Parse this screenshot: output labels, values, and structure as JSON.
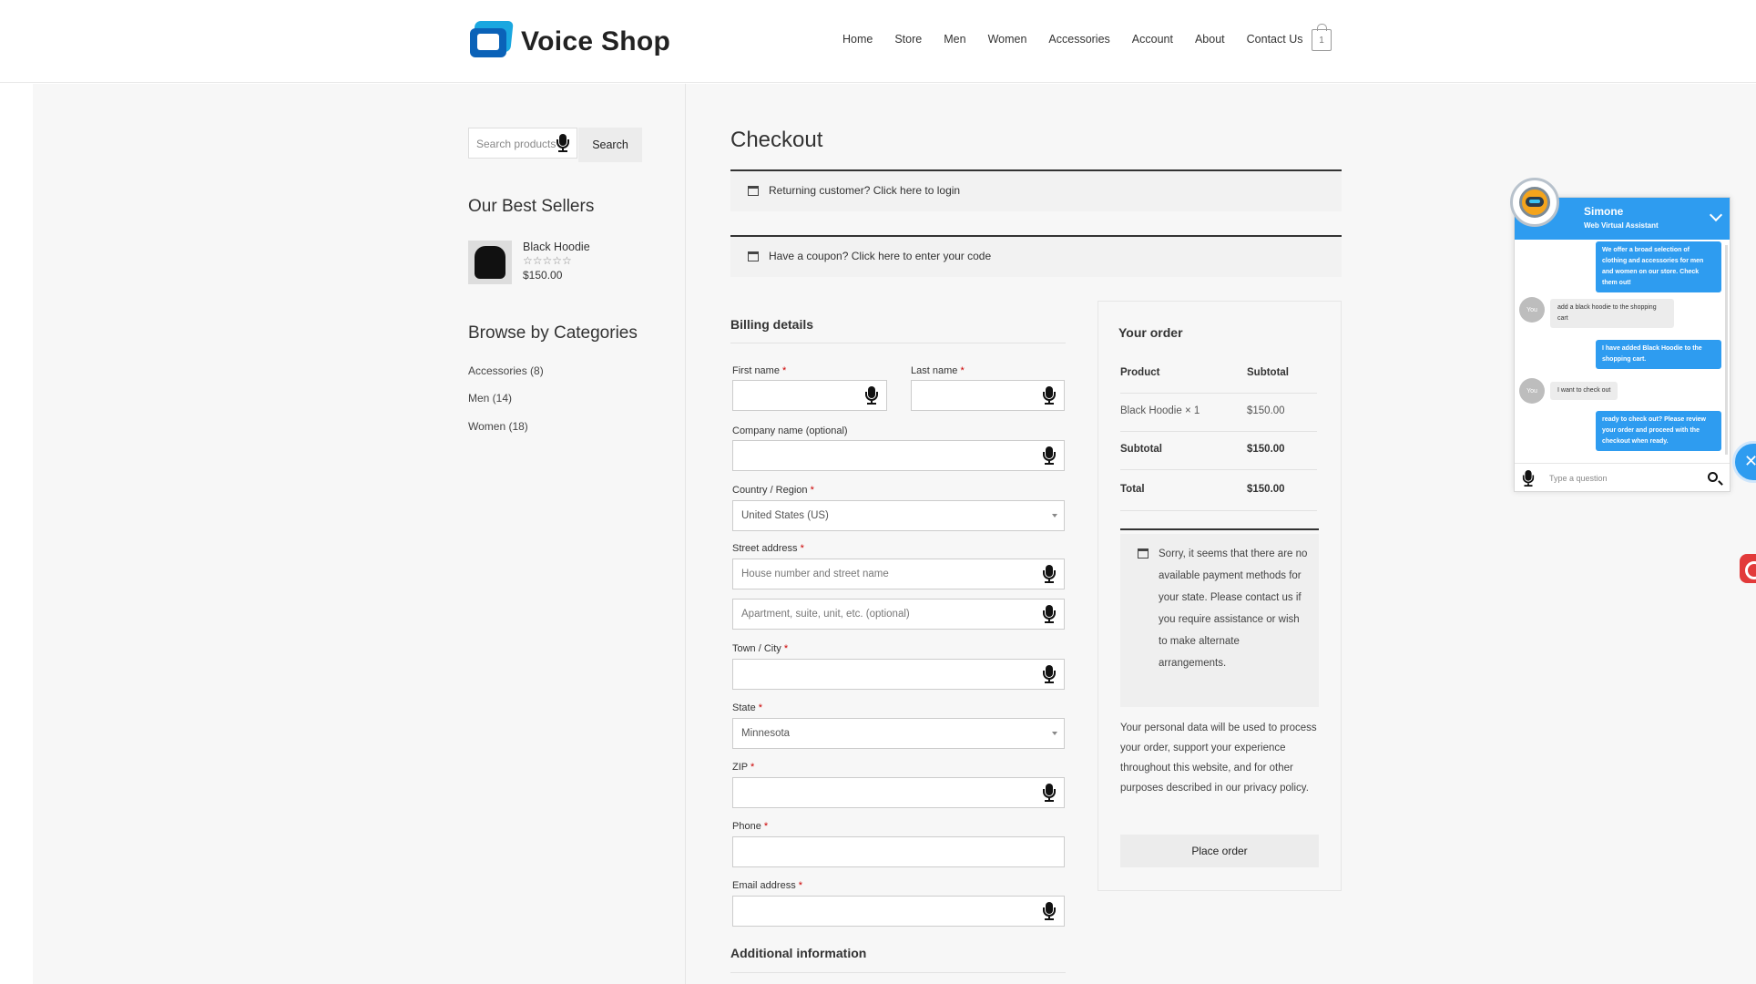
{
  "brand": {
    "name": "Voice Shop"
  },
  "nav": {
    "items": [
      "Home",
      "Store",
      "Men",
      "Women",
      "Accessories",
      "Account",
      "About",
      "Contact Us"
    ],
    "cart_count": "1"
  },
  "sidebar": {
    "search_placeholder": "Search products",
    "search_button": "Search",
    "best_sellers_title": "Our Best Sellers",
    "best_seller": {
      "name": "Black Hoodie",
      "stars": "☆☆☆☆☆",
      "price": "$150.00"
    },
    "categories_title": "Browse by Categories",
    "categories": [
      "Accessories (8)",
      "Men (14)",
      "Women (18)"
    ]
  },
  "checkout": {
    "title": "Checkout",
    "returning_notice": "Returning customer? Click here to login",
    "coupon_notice": "Have a coupon? Click here to enter your code",
    "billing_title": "Billing details",
    "labels": {
      "first_name": "First name",
      "last_name": "Last name",
      "company": "Company name (optional)",
      "country": "Country / Region",
      "street": "Street address",
      "town": "Town / City",
      "state": "State",
      "zip": "ZIP",
      "phone": "Phone",
      "email": "Email address"
    },
    "required_mark": "*",
    "values": {
      "country": "United States (US)",
      "state": "Minnesota"
    },
    "placeholders": {
      "street1": "House number and street name",
      "street2": "Apartment, suite, unit, etc. (optional)"
    },
    "additional_title": "Additional information"
  },
  "order": {
    "title": "Your order",
    "col_product": "Product",
    "col_subtotal": "Subtotal",
    "item_name": "Black Hoodie  × 1",
    "item_price": "$150.00",
    "subtotal_label": "Subtotal",
    "subtotal_value": "$150.00",
    "total_label": "Total",
    "total_value": "$150.00",
    "payment_notice": "Sorry, it seems that there are no available payment methods for your state. Please contact us if you require assistance or wish to make alternate arrangements.",
    "privacy": "Your personal data will be used to process your order, support your experience throughout this website, and for other purposes described in our privacy policy.",
    "place_order": "Place order"
  },
  "chat": {
    "name": "Simone",
    "role": "Web Virtual Assistant",
    "you_label": "You",
    "messages": [
      {
        "from": "bot",
        "text": "We offer a broad selection of clothing and accessories for men and women on our store. Check them out!"
      },
      {
        "from": "you",
        "text": "add a black hoodie to the shopping cart"
      },
      {
        "from": "bot",
        "text": "I have added Black Hoodie to the shopping cart."
      },
      {
        "from": "you",
        "text": "I want to check out"
      },
      {
        "from": "bot",
        "text": "ready to check out? Please review your order and proceed with the checkout when ready."
      }
    ],
    "input_placeholder": "Type a question",
    "close_glyph": "✕"
  },
  "colors": {
    "accent": "#2e9cf0",
    "required": "#cc0000",
    "brand_dark": "#0a62b8",
    "brand_light": "#1aa7e0"
  }
}
